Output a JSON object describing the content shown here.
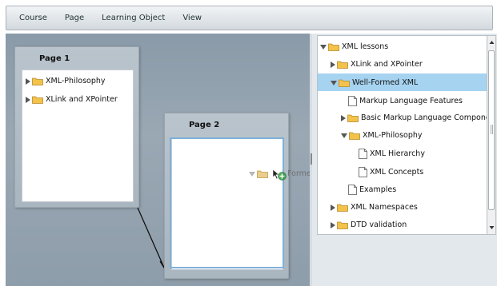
{
  "menu": {
    "items": [
      "Course",
      "Page",
      "Learning Object",
      "View"
    ]
  },
  "pages": {
    "page1": {
      "title": "Page 1",
      "items": [
        "XML-Philosophy",
        "XLink and XPointer"
      ]
    },
    "page2": {
      "title": "Page 2"
    }
  },
  "drag": {
    "label": "Formed XML"
  },
  "tree": {
    "items": [
      {
        "label": "XML lessons",
        "expanded": true,
        "type": "folder"
      },
      {
        "label": "XLink and XPointer",
        "expanded": false,
        "type": "folder"
      },
      {
        "label": "Well-Formed XML",
        "expanded": true,
        "type": "folder",
        "selected": true
      },
      {
        "label": "Markup Language Features",
        "type": "doc"
      },
      {
        "label": "Basic Markup Language Component",
        "expanded": false,
        "type": "folder"
      },
      {
        "label": "XML-Philosophy",
        "expanded": true,
        "type": "folder"
      },
      {
        "label": "XML Hierarchy",
        "type": "doc"
      },
      {
        "label": "XML Concepts",
        "type": "doc"
      },
      {
        "label": "Examples",
        "type": "doc"
      },
      {
        "label": "XML Namespaces",
        "expanded": false,
        "type": "folder"
      },
      {
        "label": "DTD validation",
        "expanded": false,
        "type": "folder"
      }
    ]
  },
  "colors": {
    "folder_yellow": "#f2c24a",
    "selection_blue": "#a6d3f0",
    "drop_border": "#7fb0d8"
  }
}
